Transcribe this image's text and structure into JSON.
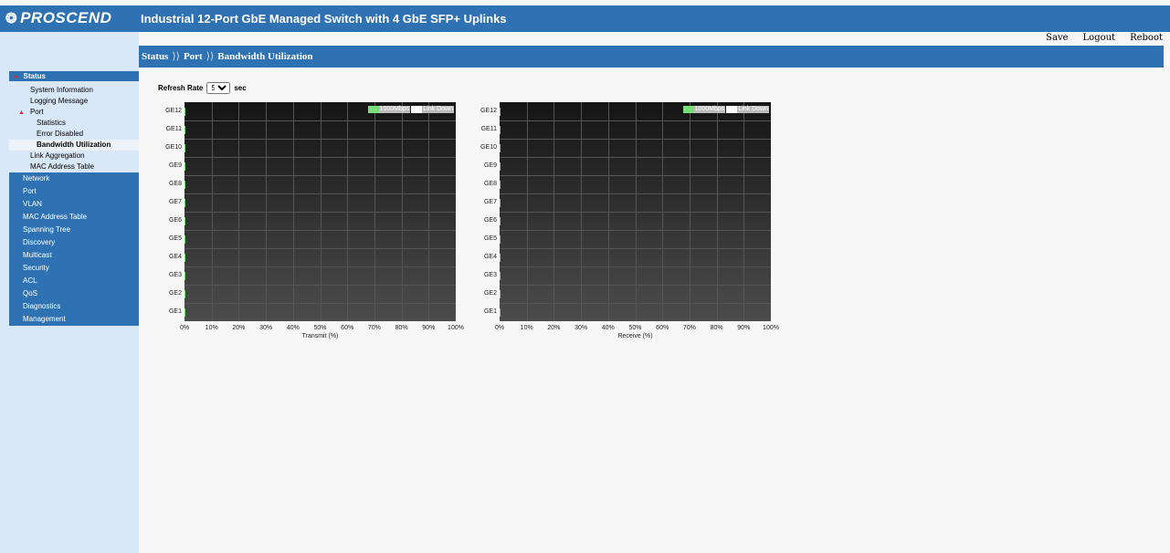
{
  "header": {
    "brand": "PROSCEND",
    "product_title": "Industrial 12-Port GbE Managed Switch with 4 GbE SFP+ Uplinks"
  },
  "actions": {
    "save": "Save",
    "logout": "Logout",
    "reboot": "Reboot"
  },
  "breadcrumb": [
    "Status",
    "Port",
    "Bandwidth Utilization"
  ],
  "refresh": {
    "label": "Refresh Rate",
    "value": "5",
    "unit": "sec"
  },
  "sidebar": {
    "status_head": "Status",
    "status_items": [
      "System Information",
      "Logging Message"
    ],
    "port_group": "Port",
    "port_items": [
      "Statistics",
      "Error Disabled",
      "Bandwidth Utilization"
    ],
    "more_items": [
      "Link Aggregation",
      "MAC Address Table"
    ],
    "categories": [
      "Network",
      "Port",
      "VLAN",
      "MAC Address Table",
      "Spanning Tree",
      "Discovery",
      "Multicast",
      "Security",
      "ACL",
      "QoS",
      "Diagnostics",
      "Management"
    ]
  },
  "chart_data": [
    {
      "type": "bar",
      "orientation": "horizontal",
      "categories": [
        "GE12",
        "GE11",
        "GE10",
        "GE9",
        "GE8",
        "GE7",
        "GE6",
        "GE5",
        "GE4",
        "GE3",
        "GE2",
        "GE1"
      ],
      "values": [
        0,
        0,
        0,
        0,
        0,
        0,
        0,
        0,
        0,
        0,
        0,
        0
      ],
      "xlabel": "Transmit (%)",
      "xticks": [
        "0%",
        "10%",
        "20%",
        "30%",
        "40%",
        "50%",
        "60%",
        "70%",
        "80%",
        "90%",
        "100%"
      ],
      "xlim": [
        0,
        100
      ],
      "legend": [
        "1000Mbps",
        "Link Down"
      ],
      "legend_position": "top-right",
      "grid": true,
      "colors": {
        "1000Mbps": "#6fdd6f",
        "Link Down": "#ffffff"
      }
    },
    {
      "type": "bar",
      "orientation": "horizontal",
      "categories": [
        "GE12",
        "GE11",
        "GE10",
        "GE9",
        "GE8",
        "GE7",
        "GE6",
        "GE5",
        "GE4",
        "GE3",
        "GE2",
        "GE1"
      ],
      "values": [
        0,
        0,
        0,
        0,
        0,
        0,
        0,
        0,
        0,
        0,
        0,
        0
      ],
      "xlabel": "Receive (%)",
      "xticks": [
        "0%",
        "10%",
        "20%",
        "30%",
        "40%",
        "50%",
        "60%",
        "70%",
        "80%",
        "90%",
        "100%"
      ],
      "xlim": [
        0,
        100
      ],
      "legend": [
        "1000Mbps",
        "Link Down"
      ],
      "legend_position": "top-right",
      "grid": true,
      "colors": {
        "1000Mbps": "#6fdd6f",
        "Link Down": "#ffffff"
      }
    }
  ]
}
